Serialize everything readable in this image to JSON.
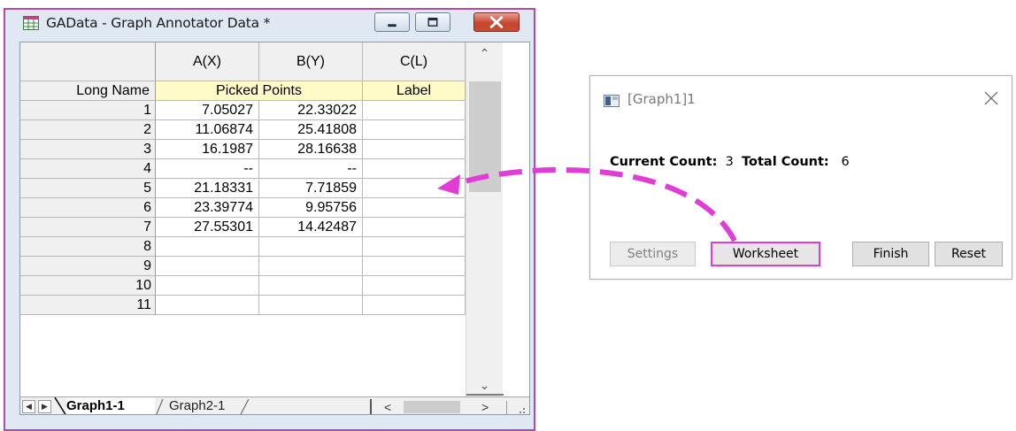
{
  "worksheet": {
    "title": "GAData - Graph Annotator Data *",
    "columns": [
      {
        "name": "A(X)"
      },
      {
        "name": "B(Y)"
      },
      {
        "name": "C(L)"
      }
    ],
    "long_name_label": "Long Name",
    "long_names": {
      "picked": "Picked Points",
      "label": "Label"
    },
    "rows": [
      {
        "n": "1",
        "x": "7.05027",
        "y": "22.33022",
        "l": ""
      },
      {
        "n": "2",
        "x": "11.06874",
        "y": "25.41808",
        "l": ""
      },
      {
        "n": "3",
        "x": "16.1987",
        "y": "28.16638",
        "l": ""
      },
      {
        "n": "4",
        "x": "--",
        "y": "--",
        "l": ""
      },
      {
        "n": "5",
        "x": "21.18331",
        "y": "7.71859",
        "l": ""
      },
      {
        "n": "6",
        "x": "23.39774",
        "y": "9.95756",
        "l": ""
      },
      {
        "n": "7",
        "x": "27.55301",
        "y": "14.42487",
        "l": ""
      },
      {
        "n": "8",
        "x": "",
        "y": "",
        "l": ""
      },
      {
        "n": "9",
        "x": "",
        "y": "",
        "l": ""
      },
      {
        "n": "10",
        "x": "",
        "y": "",
        "l": ""
      },
      {
        "n": "11",
        "x": "",
        "y": "",
        "l": ""
      }
    ],
    "tabs": {
      "active": "Graph1-1",
      "inactive": "Graph2-1"
    }
  },
  "dialog": {
    "title": "[Graph1]1",
    "current_count_label": "Current Count:",
    "current_count": "3",
    "total_count_label": "Total Count:",
    "total_count": "6",
    "buttons": {
      "settings": "Settings",
      "worksheet": "Worksheet",
      "finish": "Finish",
      "reset": "Reset"
    }
  },
  "colors": {
    "window_border": "#b24aa8",
    "long_name_bg": "#fffbc8",
    "highlight": "#e23cd6"
  }
}
